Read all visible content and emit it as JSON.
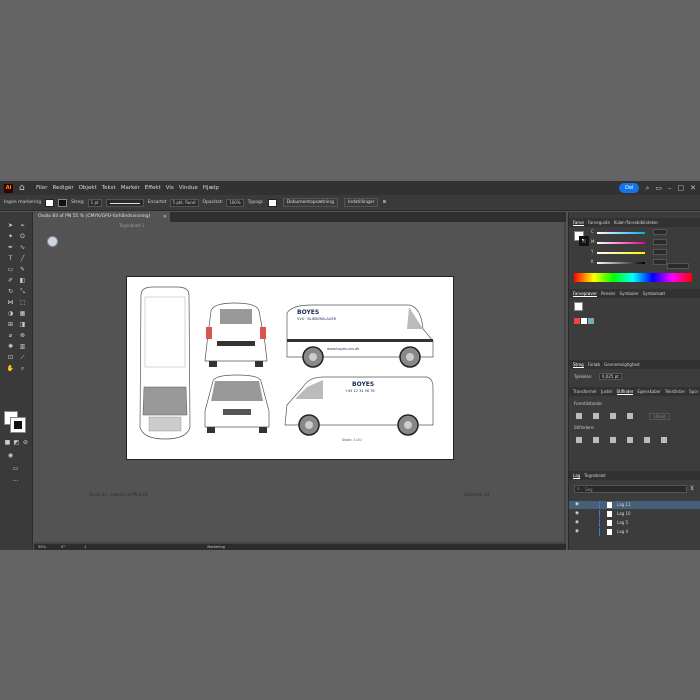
{
  "app": {
    "logo": "Ai",
    "home_icon": "home-icon"
  },
  "menu": [
    "Filer",
    "Redigér",
    "Objekt",
    "Tekst",
    "Markér",
    "Effekt",
    "Vis",
    "Vindue",
    "Hjælp"
  ],
  "menubar_right": {
    "share_label": "Del",
    "icons": [
      "search-icon",
      "window-icon",
      "minimize-icon",
      "maximize-icon",
      "close-icon"
    ]
  },
  "control_bar": {
    "selection_label": "Ingen markering",
    "stroke_label": "Streg:",
    "stroke_value": "1 pt",
    "profile_label": "Ensartet",
    "brush_label": "5 pkt. Rund",
    "opacity_label": "Opacitet:",
    "opacity_value": "100%",
    "style_label": "Typogr.",
    "doc_setup_label": "Dokumentopsætning",
    "prefs_label": "Indstillinger"
  },
  "document_tab": {
    "title": "Ovalo Bil af PN 55 % (CMYK/GPU-forhåndsvisning)",
    "close_icon": "close-icon"
  },
  "artboard": {
    "label": "Tegnebræt 1",
    "vehicle_text": [
      "BOYES",
      "VVS · BLIKKENSLAGER",
      "www.boyes-vvs.dk",
      "+45 12 34 56 78"
    ],
    "scale_note": "Skala: 1:20"
  },
  "captions": {
    "left": "Ovalo bil - tegning af PN 55%",
    "right": "Størrelse: A4"
  },
  "status_bar": {
    "zoom": "55%",
    "angle": "0°",
    "page": "1",
    "tool": "Markering"
  },
  "color_panel": {
    "tabs": [
      "Farve",
      "Farveguide",
      "Kulør-/farvebiblioteker"
    ],
    "channels": [
      {
        "letter": "C",
        "value": "0",
        "color": "#00aeef"
      },
      {
        "letter": "M",
        "value": "0",
        "color": "#ec008c"
      },
      {
        "letter": "Y",
        "value": "0",
        "color": "#fff200"
      },
      {
        "letter": "K",
        "value": "0",
        "color": "#333333"
      }
    ],
    "hex_value": "FFFFFF"
  },
  "swatches_panel": {
    "tabs": [
      "Farveprøver",
      "Pensler",
      "Symboler",
      "Symbolsæt"
    ]
  },
  "transform_panel": {
    "tabs": [
      "Streg",
      "Forløb",
      "Gennemsigtighed"
    ],
    "weight_label": "Tykkelse:",
    "weight_value": "0,025 pt"
  },
  "pathfinder_panel": {
    "tabs": [
      "Transformér",
      "Justér",
      "Stifinder",
      "Egenskaber",
      "Tekstlister",
      "Spor"
    ],
    "shape_modes_label": "Formtilstande:",
    "pathfinders_label": "Stifindere:",
    "expand_label": "Udvid"
  },
  "layers_panel": {
    "tabs": [
      "Lag",
      "Tegnebræt"
    ],
    "search_placeholder": "Søg",
    "layers": [
      {
        "name": "Lag 11",
        "selected": true
      },
      {
        "name": "Lag 10",
        "selected": false
      },
      {
        "name": "Lag 5",
        "selected": false
      },
      {
        "name": "Lag 4",
        "selected": false
      }
    ]
  }
}
